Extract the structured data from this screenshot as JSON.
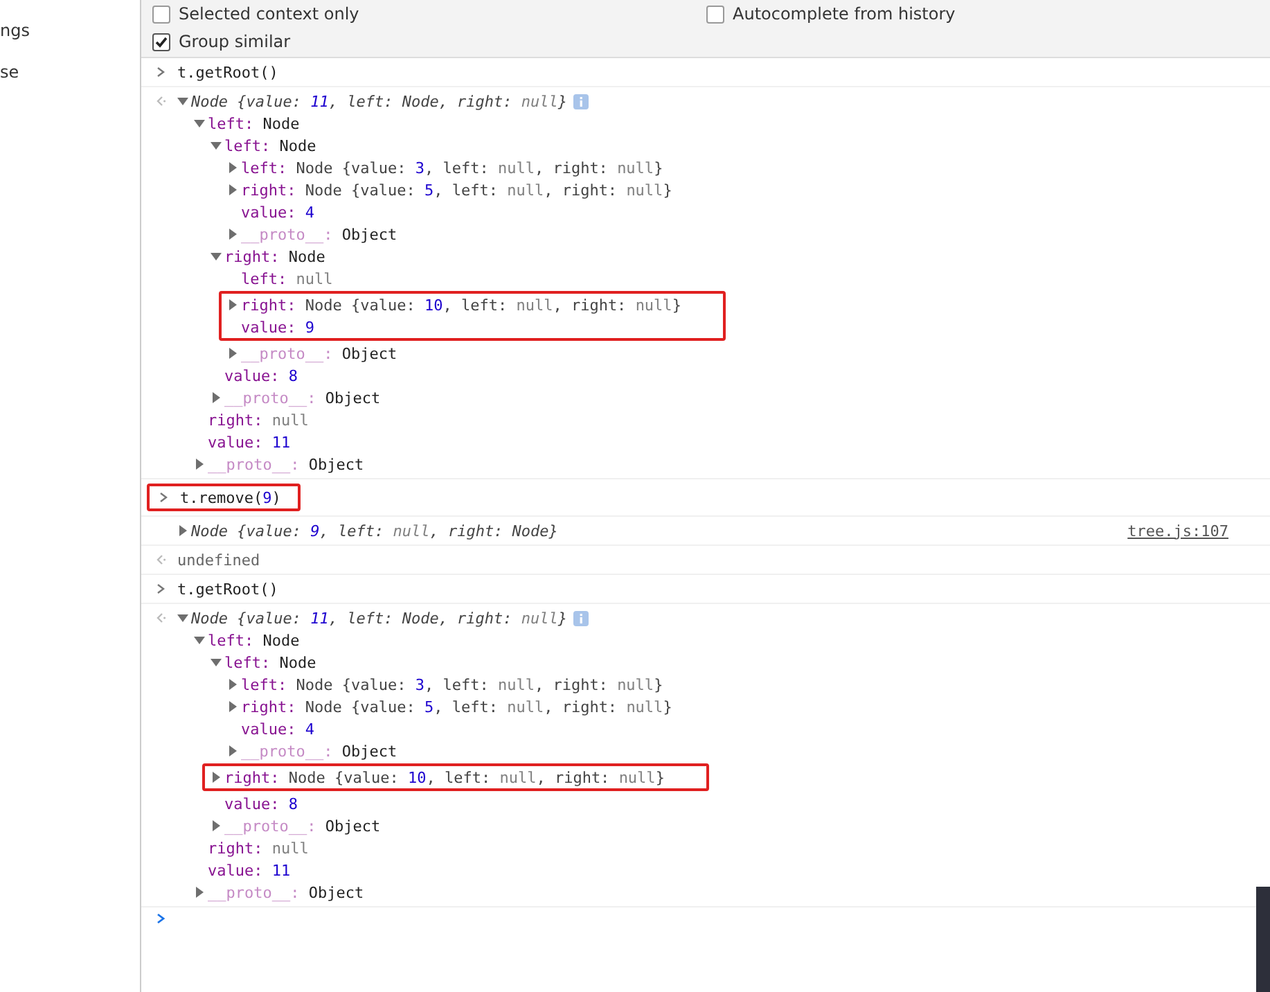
{
  "sidebar": {
    "items": [
      "ngs",
      "se"
    ]
  },
  "settings": {
    "options": [
      {
        "label": "Selected context only",
        "checked": false
      },
      {
        "label": "Autocomplete from history",
        "checked": false
      },
      {
        "label": "Group similar",
        "checked": true
      }
    ]
  },
  "console": {
    "entries": [
      {
        "kind": "input",
        "text": "t.getRoot()",
        "highlighted": false
      },
      {
        "kind": "output",
        "summary": "Node {value: 11, left: Node, right: null}",
        "expanded": true,
        "children": [
          {
            "key": "left:",
            "value": "Node",
            "kind": "node",
            "expanded": true,
            "children": [
              {
                "key": "left:",
                "value": "Node",
                "kind": "node",
                "expanded": true,
                "children": [
                  {
                    "key": "left:",
                    "value": "Node {value: 3, left: null, right: null}",
                    "kind": "preview",
                    "expanded": false
                  },
                  {
                    "key": "right:",
                    "value": "Node {value: 5, left: null, right: null}",
                    "kind": "preview",
                    "expanded": false
                  },
                  {
                    "key": "value:",
                    "value": "4",
                    "kind": "number"
                  },
                  {
                    "key": "__proto__:",
                    "value": "Object",
                    "kind": "proto",
                    "expanded": false
                  }
                ]
              },
              {
                "key": "right:",
                "value": "Node",
                "kind": "node",
                "expanded": true,
                "children": [
                  {
                    "key": "left:",
                    "value": "null",
                    "kind": "null"
                  },
                  {
                    "key": "right:",
                    "value": "Node {value: 10, left: null, right: null}",
                    "kind": "preview",
                    "expanded": false,
                    "highlighted": true
                  },
                  {
                    "key": "value:",
                    "value": "9",
                    "kind": "number",
                    "highlighted": true
                  },
                  {
                    "key": "__proto__:",
                    "value": "Object",
                    "kind": "proto",
                    "expanded": false
                  }
                ]
              },
              {
                "key": "value:",
                "value": "8",
                "kind": "number"
              },
              {
                "key": "__proto__:",
                "value": "Object",
                "kind": "proto",
                "expanded": false
              }
            ]
          },
          {
            "key": "right:",
            "value": "null",
            "kind": "null"
          },
          {
            "key": "value:",
            "value": "11",
            "kind": "number"
          },
          {
            "key": "__proto__:",
            "value": "Object",
            "kind": "proto",
            "expanded": false
          }
        ]
      },
      {
        "kind": "input",
        "text": "t.remove(9)",
        "highlighted": true
      },
      {
        "kind": "log",
        "summary": "Node {value: 9, left: null, right: Node}",
        "expanded": false,
        "source": "tree.js:107"
      },
      {
        "kind": "result",
        "text": "undefined"
      },
      {
        "kind": "input",
        "text": "t.getRoot()",
        "highlighted": false
      },
      {
        "kind": "output",
        "summary": "Node {value: 11, left: Node, right: null}",
        "expanded": true,
        "children": [
          {
            "key": "left:",
            "value": "Node",
            "kind": "node",
            "expanded": true,
            "children": [
              {
                "key": "left:",
                "value": "Node",
                "kind": "node",
                "expanded": true,
                "children": [
                  {
                    "key": "left:",
                    "value": "Node {value: 3, left: null, right: null}",
                    "kind": "preview",
                    "expanded": false
                  },
                  {
                    "key": "right:",
                    "value": "Node {value: 5, left: null, right: null}",
                    "kind": "preview",
                    "expanded": false
                  },
                  {
                    "key": "value:",
                    "value": "4",
                    "kind": "number"
                  },
                  {
                    "key": "__proto__:",
                    "value": "Object",
                    "kind": "proto",
                    "expanded": false
                  }
                ]
              },
              {
                "key": "right:",
                "value": "Node {value: 10, left: null, right: null}",
                "kind": "preview",
                "expanded": false,
                "highlighted": true
              },
              {
                "key": "value:",
                "value": "8",
                "kind": "number"
              },
              {
                "key": "__proto__:",
                "value": "Object",
                "kind": "proto",
                "expanded": false
              }
            ]
          },
          {
            "key": "right:",
            "value": "null",
            "kind": "null"
          },
          {
            "key": "value:",
            "value": "11",
            "kind": "number"
          },
          {
            "key": "__proto__:",
            "value": "Object",
            "kind": "proto",
            "expanded": false
          }
        ]
      }
    ]
  }
}
